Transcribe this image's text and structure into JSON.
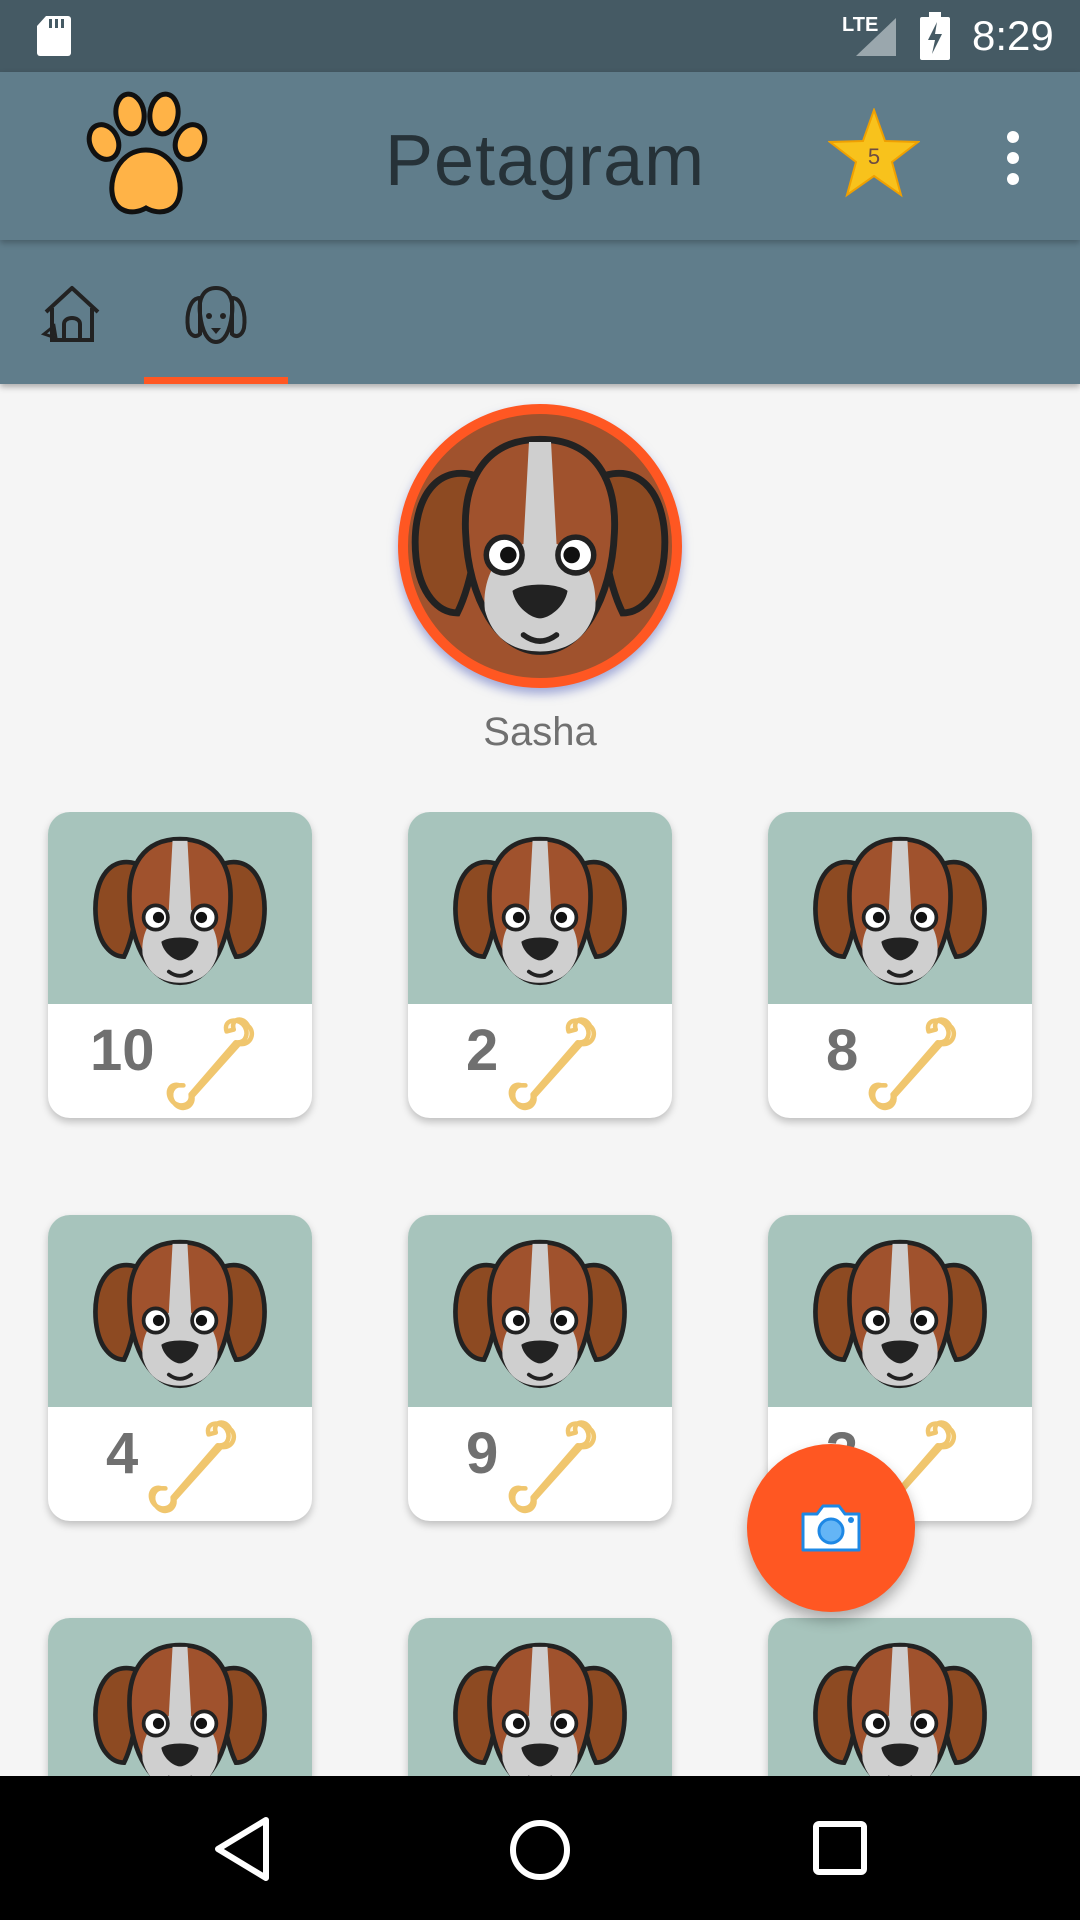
{
  "status_bar": {
    "network_label": "LTE",
    "time": "8:29",
    "icons": [
      "sd-card-icon",
      "signal-icon",
      "battery-charging-icon"
    ]
  },
  "app_bar": {
    "title": "Petagram",
    "logo_icon": "paw-icon",
    "favorites_count": "5",
    "favorites_icon": "star-icon",
    "menu_icon": "more-vert-icon"
  },
  "tabs": [
    {
      "icon": "dog-house-icon",
      "selected": false
    },
    {
      "icon": "dog-face-icon",
      "selected": true
    }
  ],
  "profile": {
    "name": "Sasha"
  },
  "photos": [
    {
      "likes": "10"
    },
    {
      "likes": "2"
    },
    {
      "likes": "8"
    },
    {
      "likes": "4"
    },
    {
      "likes": "9"
    },
    {
      "likes": "3"
    },
    {
      "likes": ""
    },
    {
      "likes": ""
    },
    {
      "likes": ""
    }
  ],
  "fab": {
    "icon": "camera-icon"
  },
  "nav_bar": {
    "icons": [
      "back-icon",
      "home-icon",
      "recents-icon"
    ]
  },
  "colors": {
    "status_bar": "#455a64",
    "app_bar": "#607d8b",
    "accent": "#ff5722",
    "card_image_bg": "#a7c4bc",
    "background": "#f5f5f5"
  }
}
